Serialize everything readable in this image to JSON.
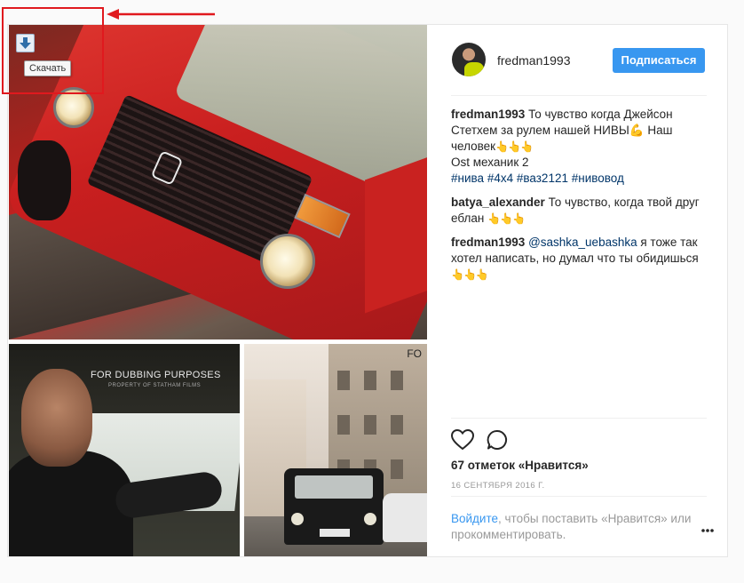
{
  "post": {
    "author": "fredman1993",
    "follow_label": "Подписаться",
    "media": {
      "download_tooltip": "Скачать",
      "still1_caption": "FOR DUBBING PURPOSES",
      "still1_subcaption": "PROPERTY OF STATHAM FILMS",
      "still2_corner_text": "FO"
    },
    "comments": [
      {
        "author": "fredman1993",
        "text": "То чувство когда Джейсон Стетхем за рулем нашей НИВЫ",
        "emoji_flex": "💪",
        "text_after_flex": " Наш человек",
        "emoji_points": "👆👆👆",
        "line2": "Ost механик 2",
        "hashtags": [
          "#нива",
          "#4x4",
          "#ваз2121",
          "#нивовод"
        ]
      },
      {
        "author": "batya_alexander",
        "text": "То чувство, когда твой друг еблан",
        "emoji_points": "👆👆👆"
      },
      {
        "author": "fredman1993",
        "mention": "@sashka_uebashka",
        "text": " я тоже так хотел написать, но думал что ты обидишься",
        "emoji_points": "👆👆👆"
      }
    ],
    "likes_text": "67 отметок «Нравится»",
    "date": "16 СЕНТЯБРЯ 2016 Г.",
    "login_link": "Войдите",
    "login_text": ", чтобы поставить «Нравится» или прокомментировать.",
    "icons": {
      "like": "heart-outline-icon",
      "comment": "comment-bubble-icon",
      "more": "more-options-icon",
      "download": "download-arrow-icon"
    },
    "colors": {
      "follow_button": "#3897f0",
      "link": "#3897f0",
      "hashtag": "#003569",
      "highlight": "#e0191e"
    }
  }
}
